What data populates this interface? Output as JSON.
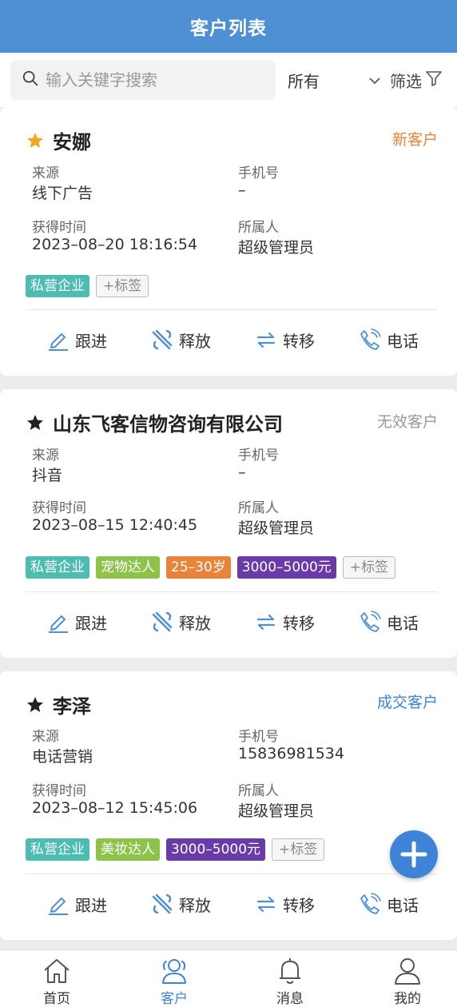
{
  "header": {
    "title": "客户列表"
  },
  "search": {
    "placeholder": "输入关键字搜索"
  },
  "filter": {
    "select_value": "所有",
    "filter_label": "筛选"
  },
  "field_labels": {
    "source": "来源",
    "phone": "手机号",
    "time": "获得时间",
    "owner": "所属人"
  },
  "actions": {
    "follow": "跟进",
    "release": "释放",
    "transfer": "转移",
    "call": "电话"
  },
  "add_tag_label": "+标签",
  "customers": [
    {
      "name": "安娜",
      "starred": true,
      "status": "新客户",
      "status_color": "#e8833a",
      "source": "线下广告",
      "phone": "–",
      "time": "2023–08–20 18:16:54",
      "owner": "超级管理员",
      "tags": [
        {
          "label": "私营企业",
          "color": "#4dbcb1"
        }
      ]
    },
    {
      "name": "山东飞客信物咨询有限公司",
      "starred": false,
      "status": "无效客户",
      "status_color": "#999999",
      "source": "抖音",
      "phone": "–",
      "time": "2023–08–15 12:40:45",
      "owner": "超级管理员",
      "tags": [
        {
          "label": "私营企业",
          "color": "#4dbcb1"
        },
        {
          "label": "宠物达人",
          "color": "#8dc34a"
        },
        {
          "label": "25–30岁",
          "color": "#e8833a"
        },
        {
          "label": "3000–5000元",
          "color": "#6a3aa8"
        }
      ]
    },
    {
      "name": "李泽",
      "starred": false,
      "status": "成交客户",
      "status_color": "#3d84d8",
      "source": "电话营销",
      "phone": "15836981534",
      "time": "2023–08–12 15:45:06",
      "owner": "超级管理员",
      "tags": [
        {
          "label": "私营企业",
          "color": "#4dbcb1"
        },
        {
          "label": "美妆达人",
          "color": "#8dc34a"
        },
        {
          "label": "3000–5000元",
          "color": "#6a3aa8"
        }
      ]
    }
  ],
  "tabbar": [
    {
      "label": "首页",
      "icon": "home-icon",
      "active": false
    },
    {
      "label": "客户",
      "icon": "customers-icon",
      "active": true
    },
    {
      "label": "消息",
      "icon": "bell-icon",
      "active": false
    },
    {
      "label": "我的",
      "icon": "user-icon",
      "active": false
    }
  ],
  "colors": {
    "primary": "#4f8fd4",
    "accent": "#3d84d8",
    "star_gold": "#f5a623"
  }
}
